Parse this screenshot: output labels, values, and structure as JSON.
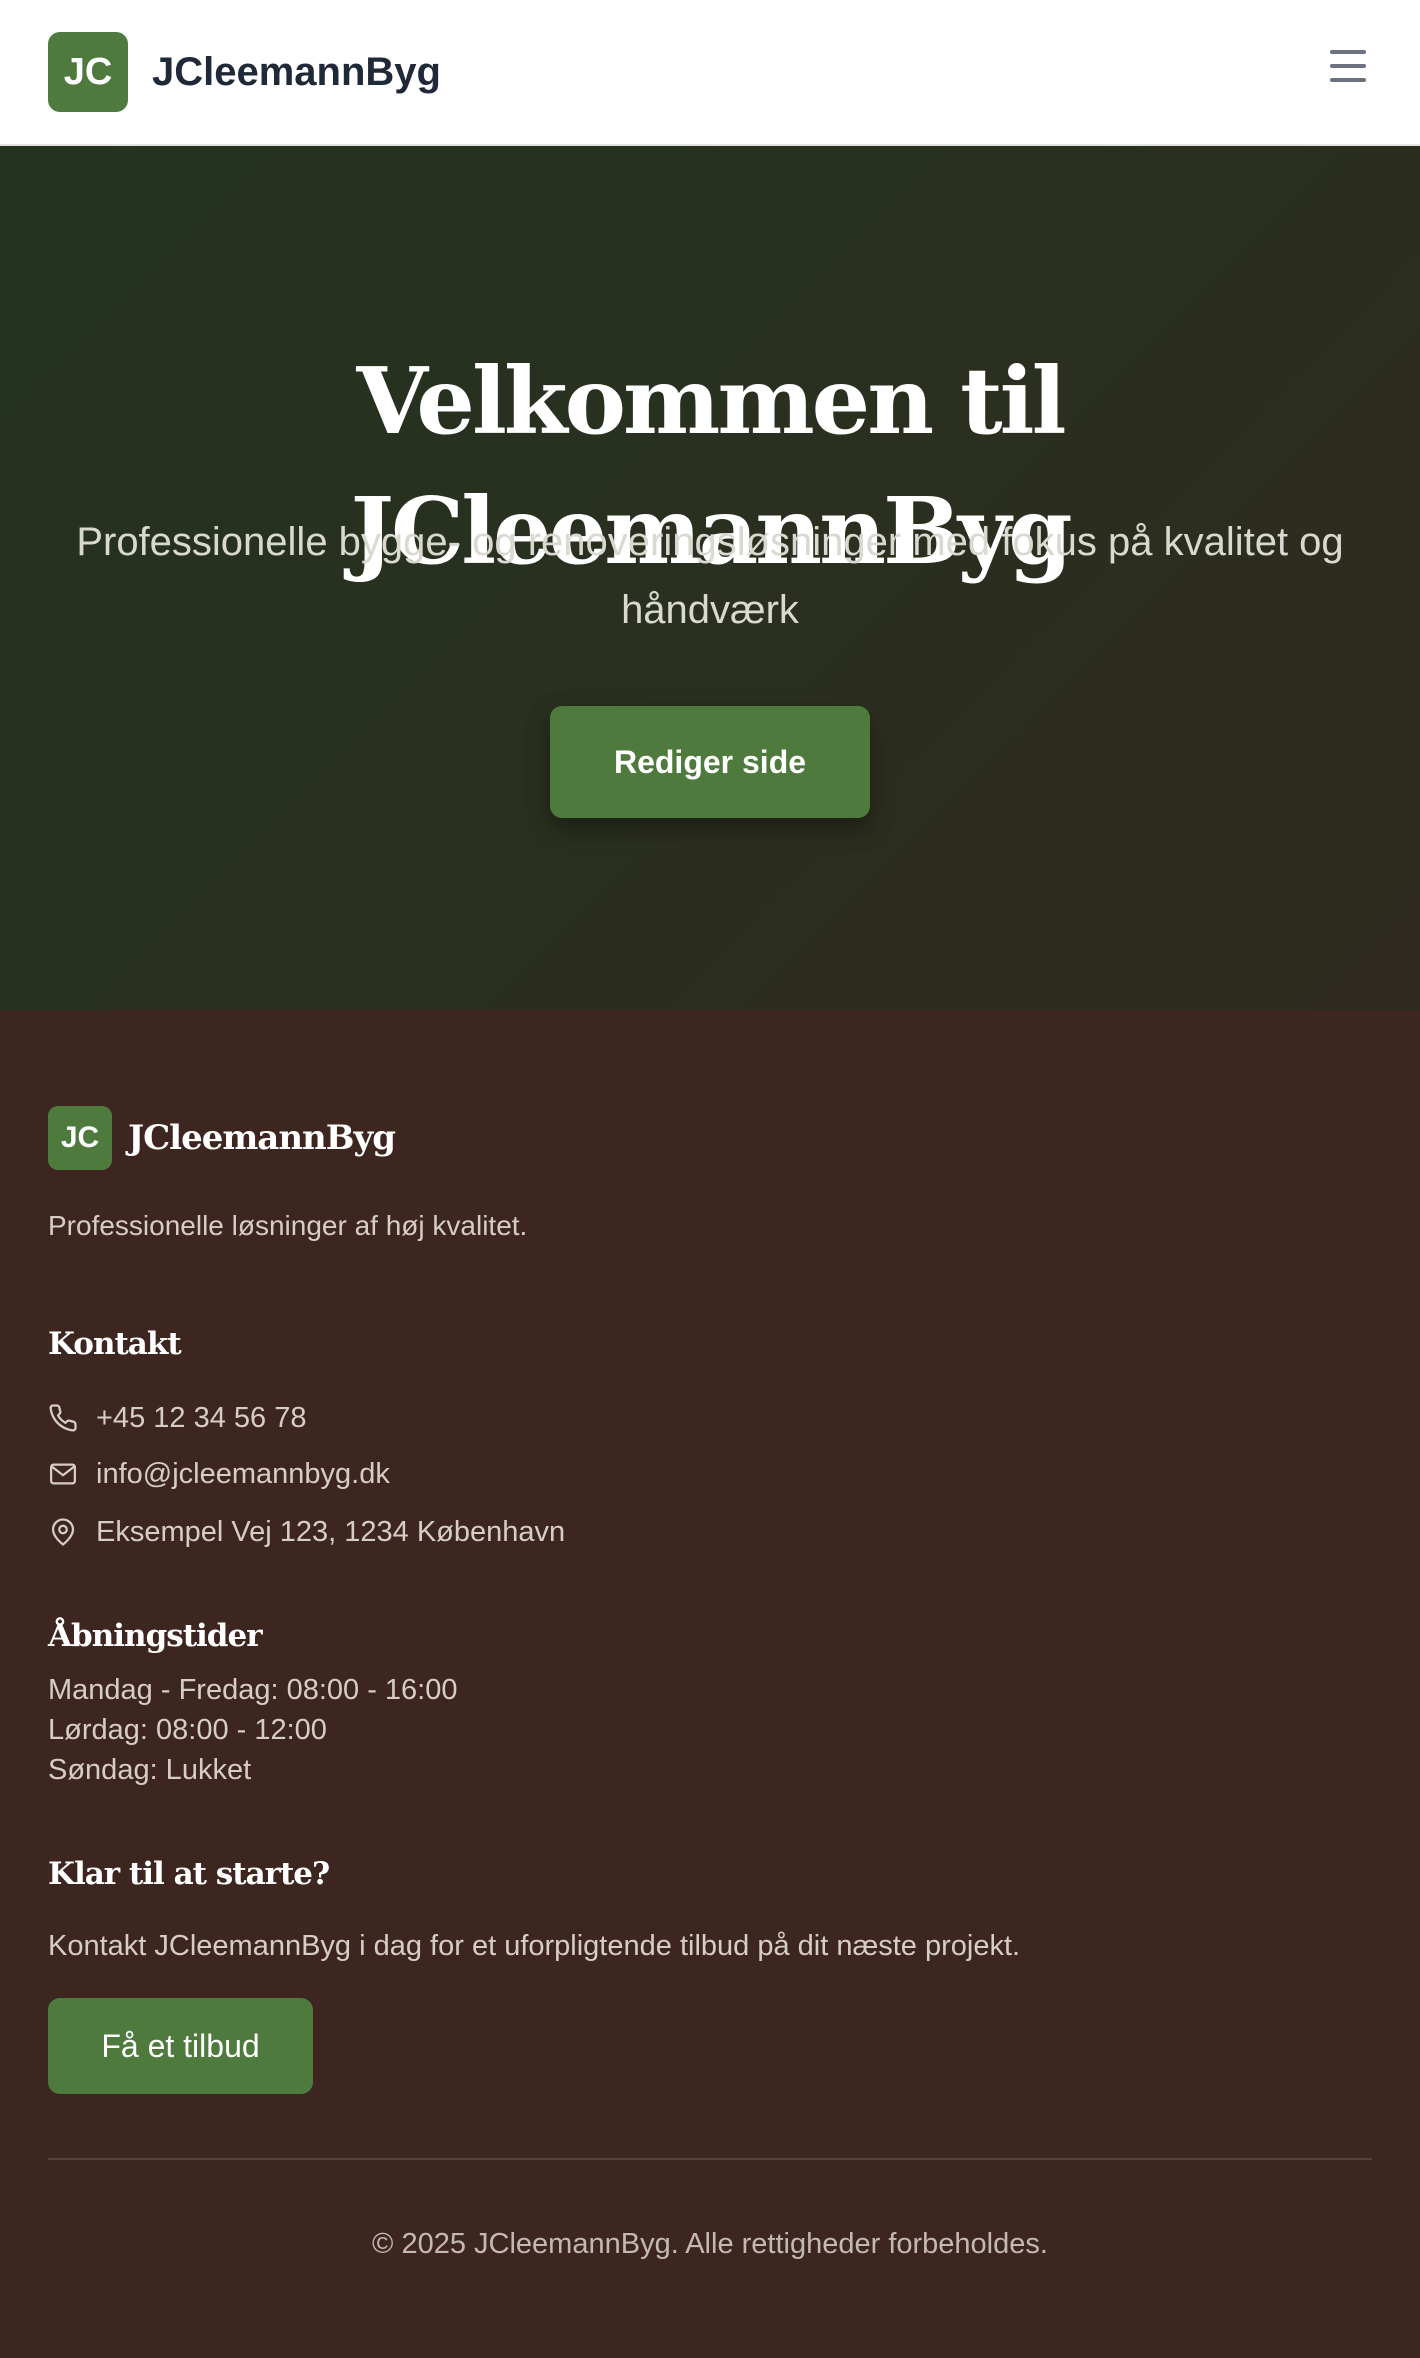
{
  "header": {
    "logo_initials": "JC",
    "brand": "JCleemannByg",
    "menu_icon": "hamburger-menu-icon"
  },
  "hero": {
    "title": "Velkommen til JCleemannByg",
    "subtitle": "Professionelle bygge- og renoveringsløsninger med fokus på kvalitet og håndværk",
    "button_label": "Rediger side"
  },
  "footer": {
    "logo_initials": "JC",
    "brand": "JCleemannByg",
    "tagline": "Professionelle løsninger af høj kvalitet.",
    "contact": {
      "heading": "Kontakt",
      "phone": "+45 12 34 56 78",
      "email": "info@jcleemannbyg.dk",
      "address": "Eksempel Vej 123, 1234 København"
    },
    "hours": {
      "heading": "Åbningstider",
      "lines": [
        "Mandag - Fredag: 08:00 - 16:00",
        "Lørdag: 08:00 - 12:00",
        "Søndag: Lukket"
      ]
    },
    "cta": {
      "heading": "Klar til at starte?",
      "text": "Kontakt JCleemannByg i dag for et uforpligtende tilbud på dit næste projekt.",
      "button_label": "Få et tilbud"
    },
    "copyright": "© 2025 JCleemannByg. Alle rettigheder forbeholdes."
  },
  "colors": {
    "accent_green": "#4e7a3e",
    "hero_bg": "#24331f",
    "footer_bg": "#3d2620",
    "header_bg": "#ffffff"
  }
}
